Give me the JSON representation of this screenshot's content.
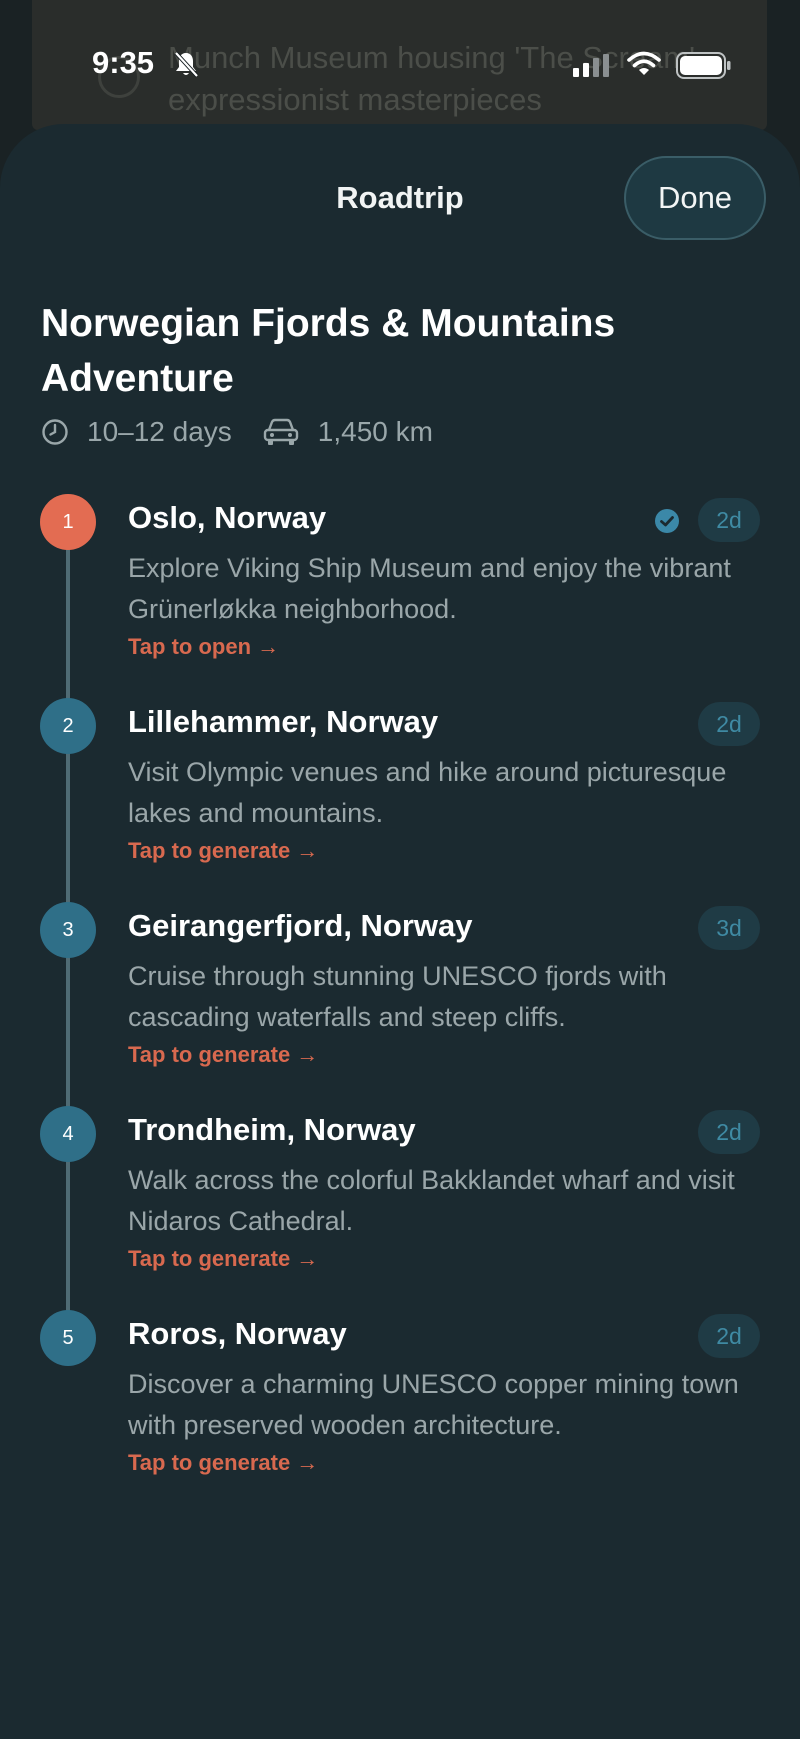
{
  "status_bar": {
    "time": "9:35",
    "icons": [
      "bell-slash-icon",
      "signal-icon",
      "wifi-icon",
      "battery-icon"
    ]
  },
  "background": {
    "line1": "Munch Museum housing 'The Scream'",
    "line2": "expressionist masterpieces"
  },
  "sheet": {
    "title": "Roadtrip",
    "done_label": "Done"
  },
  "trip": {
    "title": "Norwegian Fjords & Mountains Adventure",
    "duration": "10–12 days",
    "distance": "1,450 km"
  },
  "stops": [
    {
      "number": "1",
      "name": "Oslo, Norway",
      "description": "Explore Viking Ship Museum and enjoy the vibrant Grünerløkka neighborhood.",
      "action": "Tap to open →",
      "days": "2d"
    },
    {
      "number": "2",
      "name": "Lillehammer, Norway",
      "description": "Visit Olympic venues and hike around picturesque lakes and mountains.",
      "action": "Tap to generate →",
      "days": "2d"
    },
    {
      "number": "3",
      "name": "Geirangerfjord, Norway",
      "description": "Cruise through stunning UNESCO fjords with cascading waterfalls and steep cliffs.",
      "action": "Tap to generate →",
      "days": "3d"
    },
    {
      "number": "4",
      "name": "Trondheim, Norway",
      "description": "Walk across the colorful Bakklandet wharf and visit Nidaros Cathedral.",
      "action": "Tap to generate →",
      "days": "2d"
    },
    {
      "number": "5",
      "name": "Roros, Norway",
      "description": "Discover a charming UNESCO copper mining town with preserved wooden architecture.",
      "action": "Tap to generate →",
      "days": "2d"
    }
  ],
  "colors": {
    "sheet_bg": "#1b2a30",
    "accent_orange": "#e36c52",
    "accent_blue": "#2f6f88",
    "link_orange": "#d8694f"
  }
}
